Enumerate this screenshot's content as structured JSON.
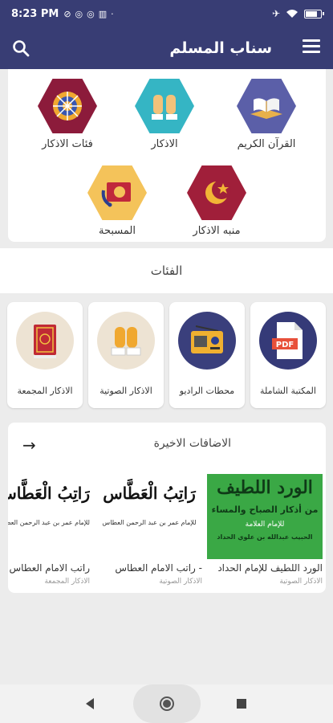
{
  "status_bar": {
    "time": "8:23 PM"
  },
  "app_bar": {
    "title": "سناب المسلم"
  },
  "top_items": [
    {
      "label": "القرآن الكريم"
    },
    {
      "label": "الاذكار"
    },
    {
      "label": "فئات الاذكار"
    },
    {
      "label": "منبه الاذكار"
    },
    {
      "label": "المسبحة"
    }
  ],
  "categories": {
    "header": "الفئات",
    "items": [
      {
        "label": "المكتبة الشاملة"
      },
      {
        "label": "محطات الراديو"
      },
      {
        "label": "الاذكار الصوتية"
      },
      {
        "label": "الاذكار المجمعة"
      }
    ]
  },
  "recent": {
    "title": "الاضافات الاخيرة",
    "items": [
      {
        "thumb_title": "الورد اللطيف",
        "thumb_line1": "من أذكار الصباح والمساء",
        "thumb_line2": "للإمام العلامة",
        "thumb_line3": "الحبيب عبدالله بن علوي الحداد",
        "title": "الورد اللطيف للإمام الحداد",
        "subtitle": "الاذكار الصوتية"
      },
      {
        "thumb_title": "رَاتِبُ الْعَطَّاس",
        "thumb_line1": "للإمام عمر بن عبد الرحمن العطاس",
        "title": "راتب الامام العطاس -",
        "subtitle": "الاذكار الصوتية"
      },
      {
        "thumb_title": "رَاتِبُ الْعَطَّاس",
        "thumb_line1": "للإمام عمر بن عبد الرحمن العطاس",
        "title": "راتب الامام العطاس",
        "subtitle": "الاذكار المجمعة"
      }
    ]
  },
  "colors": {
    "primary": "#383d74",
    "accent_green": "#3aa845"
  }
}
